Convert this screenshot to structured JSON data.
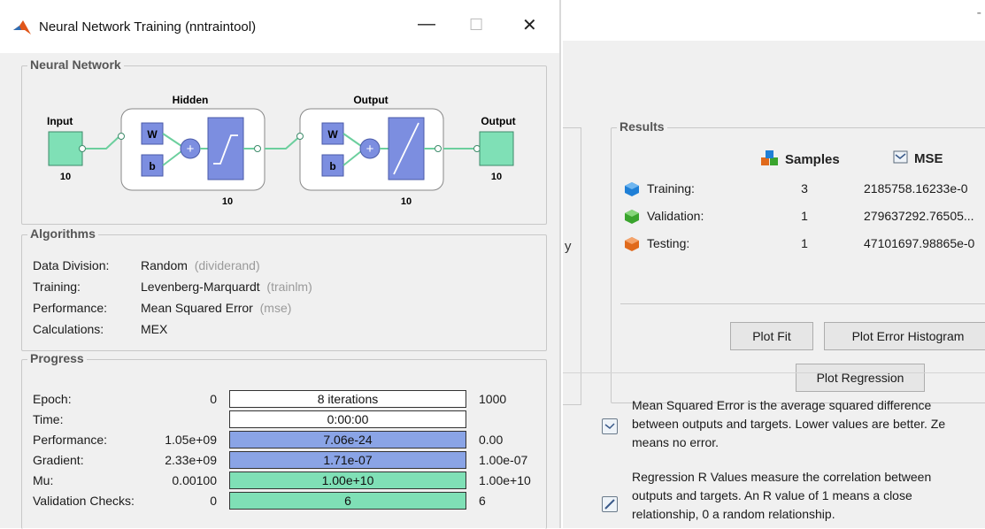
{
  "window": {
    "title": "Neural Network Training (nntraintool)"
  },
  "neural_network": {
    "title": "Neural Network",
    "input_label": "Input",
    "input_size": "10",
    "hidden_label": "Hidden",
    "hidden_size": "10",
    "output_label": "Output",
    "output_size": "10",
    "output_right_label": "Output",
    "output_right_size": "10",
    "w": "W",
    "b": "b"
  },
  "algorithms": {
    "title": "Algorithms",
    "rows": [
      {
        "label": "Data Division:",
        "value": "Random",
        "fn": "(dividerand)"
      },
      {
        "label": "Training:",
        "value": "Levenberg-Marquardt",
        "fn": "(trainlm)"
      },
      {
        "label": "Performance:",
        "value": "Mean Squared Error",
        "fn": "(mse)"
      },
      {
        "label": "Calculations:",
        "value": "MEX",
        "fn": ""
      }
    ]
  },
  "progress": {
    "title": "Progress",
    "rows": [
      {
        "label": "Epoch:",
        "lo": "0",
        "bar": "8 iterations",
        "hi": "1000",
        "fill": 0.0,
        "color": "#ffffff"
      },
      {
        "label": "Time:",
        "lo": "",
        "bar": "0:00:00",
        "hi": "",
        "fill": 0.0,
        "color": "#ffffff"
      },
      {
        "label": "Performance:",
        "lo": "1.05e+09",
        "bar": "7.06e-24",
        "hi": "0.00",
        "fill": 1.0,
        "color": "#8aa4e6"
      },
      {
        "label": "Gradient:",
        "lo": "2.33e+09",
        "bar": "1.71e-07",
        "hi": "1.00e-07",
        "fill": 1.0,
        "color": "#8aa4e6"
      },
      {
        "label": "Mu:",
        "lo": "0.00100",
        "bar": "1.00e+10",
        "hi": "1.00e+10",
        "fill": 1.0,
        "color": "#7fe0b6"
      },
      {
        "label": "Validation Checks:",
        "lo": "0",
        "bar": "6",
        "hi": "6",
        "fill": 1.0,
        "color": "#7fe0b6"
      }
    ]
  },
  "background": {
    "stray_char": "y",
    "corner_mark": "-"
  },
  "results": {
    "title": "Results",
    "samples_header": "Samples",
    "mse_header": "MSE",
    "rows": [
      {
        "name": "Training:",
        "samples": "3",
        "mse": "2185758.16233e-0",
        "icon_color": "#1f7fd6"
      },
      {
        "name": "Validation:",
        "samples": "1",
        "mse": "279637292.76505...",
        "icon_color": "#3aa42d"
      },
      {
        "name": "Testing:",
        "samples": "1",
        "mse": "47101697.98865e-0",
        "icon_color": "#e06a1c"
      }
    ],
    "buttons": {
      "plot_fit": "Plot Fit",
      "plot_error_histogram": "Plot Error Histogram",
      "plot_regression": "Plot Regression"
    }
  },
  "descriptions": {
    "mse_lines": [
      "Mean Squared Error is the average squared difference",
      "between outputs and targets. Lower values are better. Ze",
      "means no error."
    ],
    "r_lines": [
      "Regression R Values measure the correlation between",
      "outputs and targets. An R value of 1 means a close",
      "relationship, 0 a random relationship."
    ]
  },
  "colors": {
    "nn_green": "#7fe0b6",
    "nn_blue": "#7c8ee0",
    "accent_bar_blue": "#8aa4e6"
  }
}
